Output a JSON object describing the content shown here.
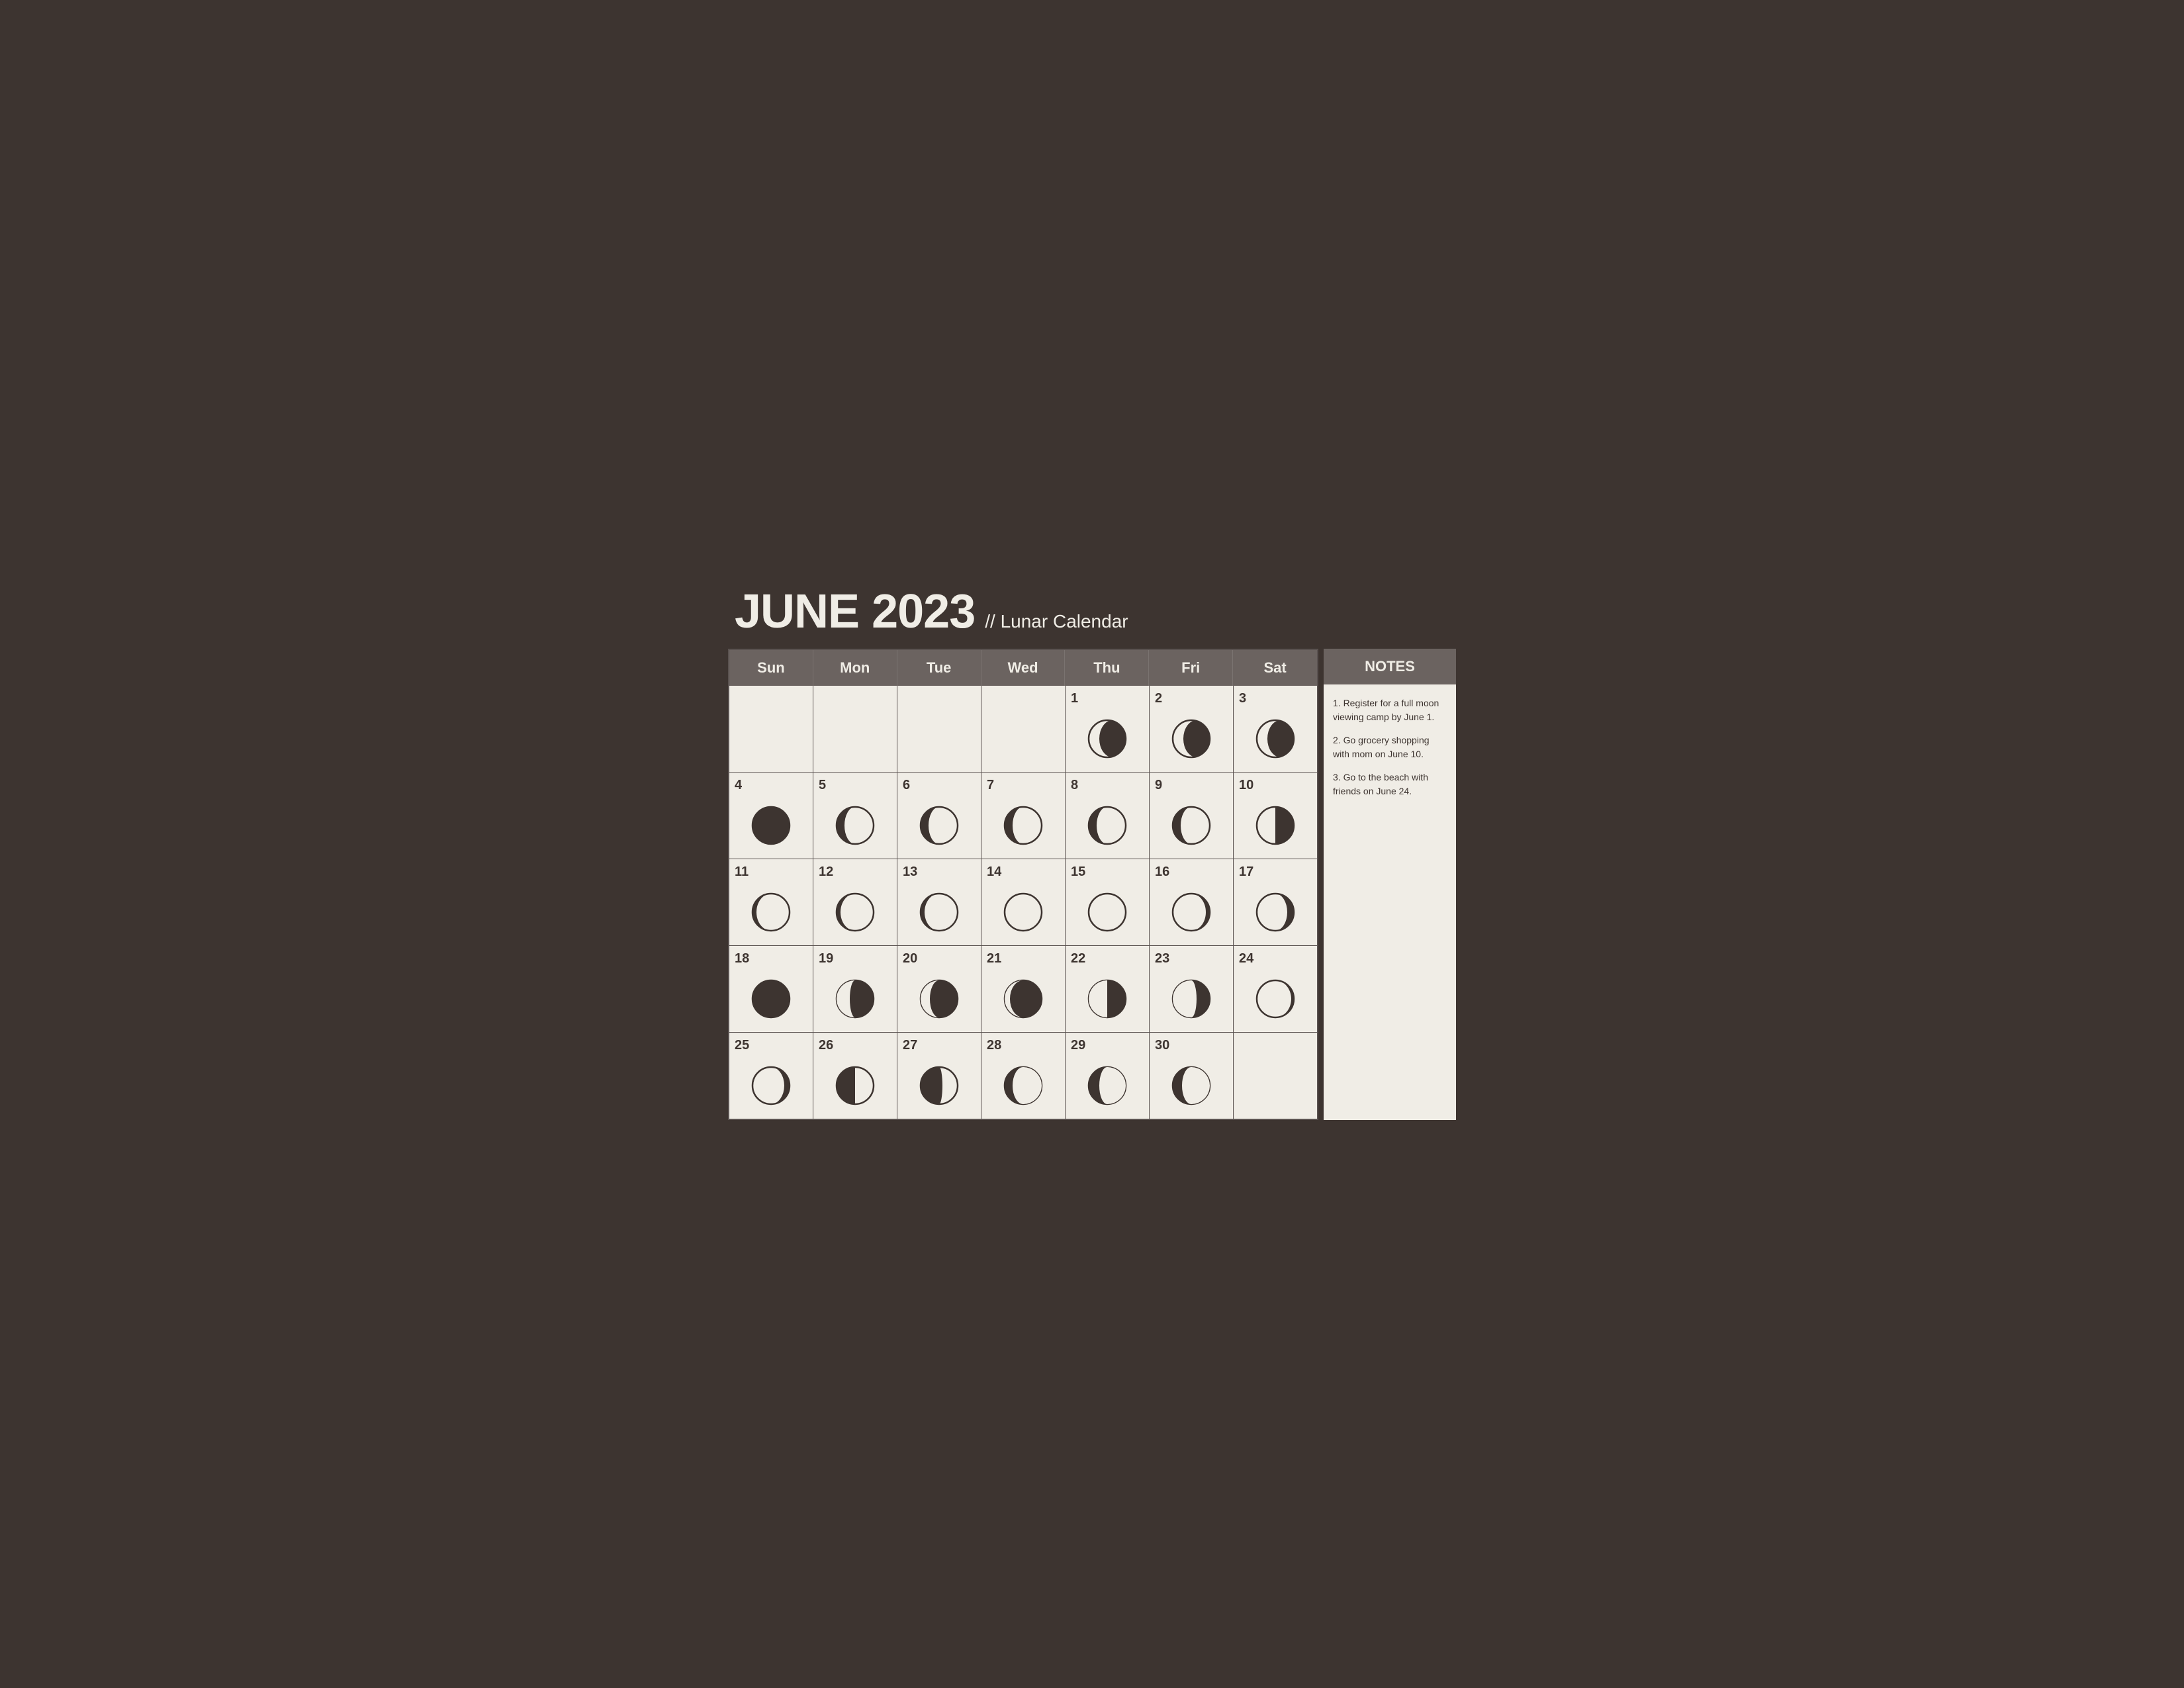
{
  "header": {
    "title": "JUNE 2023",
    "separator": "//",
    "subtitle": "Lunar Calendar"
  },
  "day_headers": [
    "Sun",
    "Mon",
    "Tue",
    "Wed",
    "Thu",
    "Fri",
    "Sat"
  ],
  "notes_header": "NOTES",
  "notes": [
    "1. Register for a full moon viewing camp by June 1.",
    "2. Go grocery shopping with mom on June 10.",
    "3. Go to the beach with friends on June 24."
  ],
  "weeks": [
    [
      {
        "day": "",
        "phase": "empty"
      },
      {
        "day": "",
        "phase": "empty"
      },
      {
        "day": "",
        "phase": "empty"
      },
      {
        "day": "",
        "phase": "empty"
      },
      {
        "day": "1",
        "phase": "waxing_gibbous"
      },
      {
        "day": "2",
        "phase": "waxing_gibbous"
      },
      {
        "day": "3",
        "phase": "waxing_gibbous"
      }
    ],
    [
      {
        "day": "4",
        "phase": "new_moon"
      },
      {
        "day": "5",
        "phase": "waxing_crescent"
      },
      {
        "day": "6",
        "phase": "waxing_crescent"
      },
      {
        "day": "7",
        "phase": "waxing_crescent"
      },
      {
        "day": "8",
        "phase": "waxing_crescent"
      },
      {
        "day": "9",
        "phase": "waxing_crescent"
      },
      {
        "day": "10",
        "phase": "first_quarter"
      }
    ],
    [
      {
        "day": "11",
        "phase": "waxing_crescent_light"
      },
      {
        "day": "12",
        "phase": "waxing_crescent_light"
      },
      {
        "day": "13",
        "phase": "waxing_crescent_light"
      },
      {
        "day": "14",
        "phase": "waxing_gibbous_light"
      },
      {
        "day": "15",
        "phase": "waxing_gibbous_light"
      },
      {
        "day": "16",
        "phase": "waxing_gibbous_light2"
      },
      {
        "day": "17",
        "phase": "waxing_gibbous_light3"
      }
    ],
    [
      {
        "day": "18",
        "phase": "full_moon"
      },
      {
        "day": "19",
        "phase": "waning_gibbous"
      },
      {
        "day": "20",
        "phase": "waning_gibbous2"
      },
      {
        "day": "21",
        "phase": "waning_gibbous3"
      },
      {
        "day": "22",
        "phase": "waning_gibbous4"
      },
      {
        "day": "23",
        "phase": "waning_gibbous5"
      },
      {
        "day": "24",
        "phase": "waning_crescent"
      }
    ],
    [
      {
        "day": "25",
        "phase": "waning_crescent2"
      },
      {
        "day": "26",
        "phase": "last_quarter"
      },
      {
        "day": "27",
        "phase": "last_quarter2"
      },
      {
        "day": "28",
        "phase": "waning_crescent3"
      },
      {
        "day": "29",
        "phase": "waning_crescent4"
      },
      {
        "day": "30",
        "phase": "waning_crescent5"
      },
      {
        "day": "",
        "phase": "empty"
      }
    ]
  ]
}
